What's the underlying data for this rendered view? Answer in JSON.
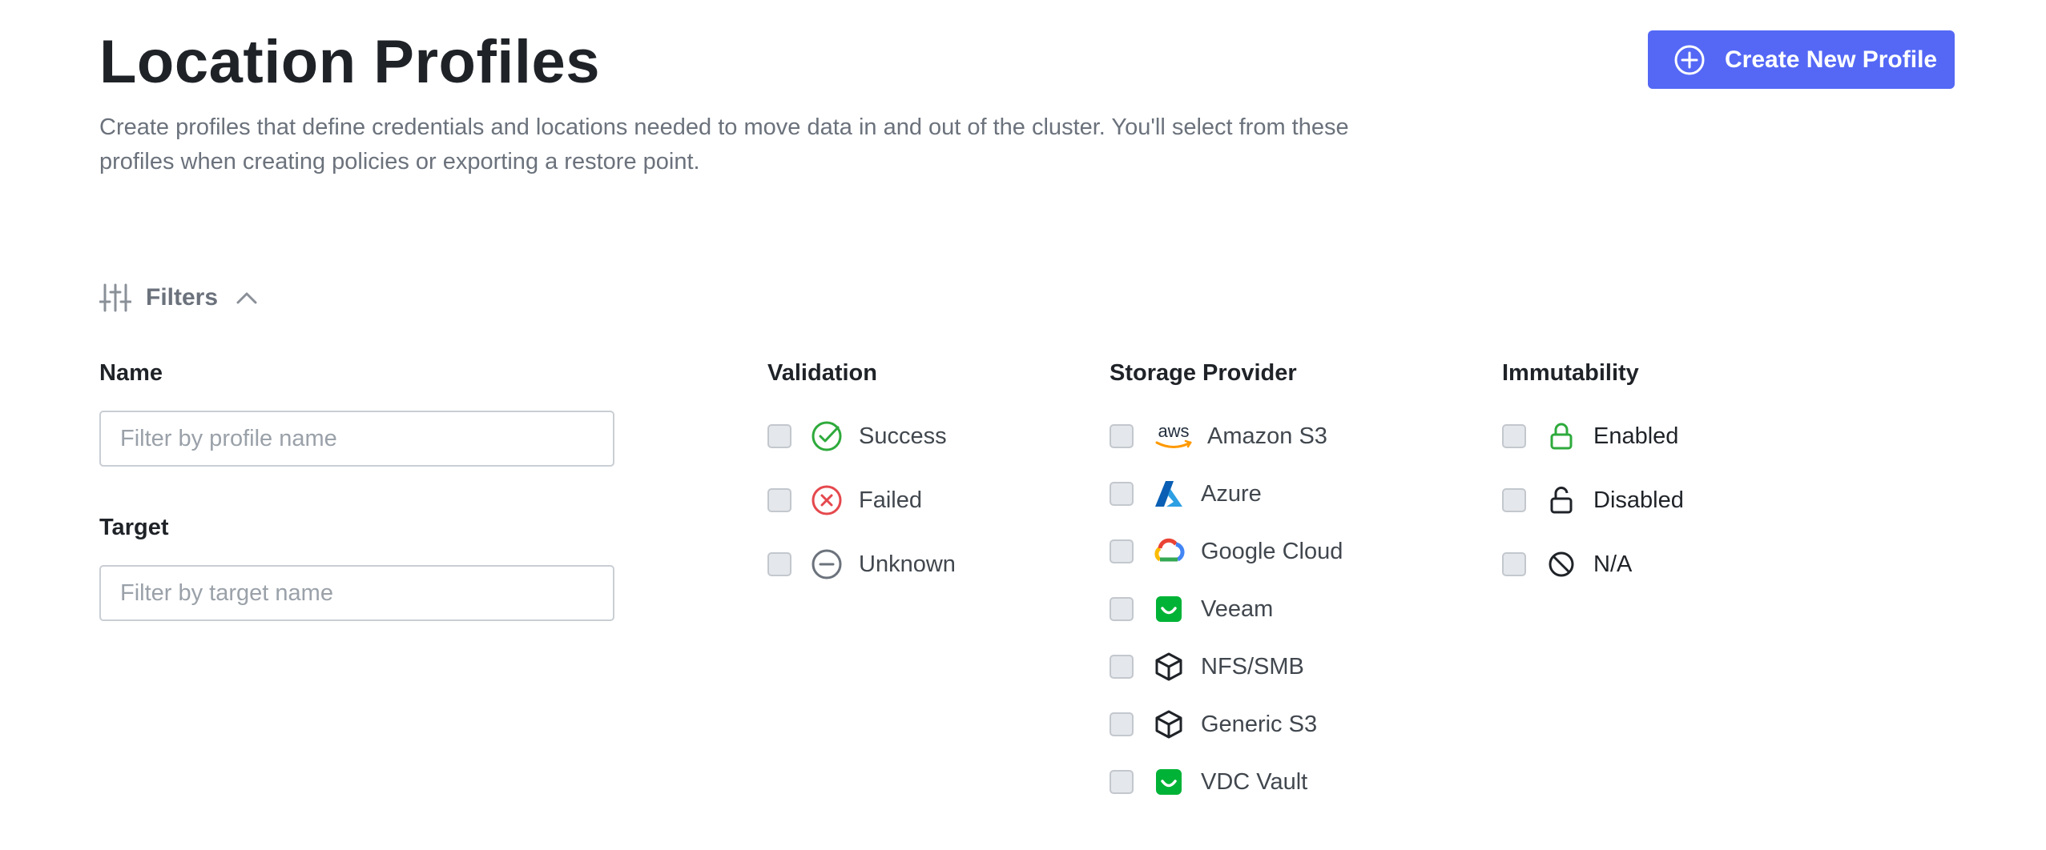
{
  "header": {
    "title": "Location Profiles",
    "description": "Create profiles that define credentials and locations needed to move data in and out of the cluster. You'll select from these profiles when creating policies or exporting a restore point.",
    "create_button_label": "Create New Profile",
    "create_button_color": "#5468f5"
  },
  "filters": {
    "toggle_label": "Filters",
    "name": {
      "label": "Name",
      "placeholder": "Filter by profile name",
      "value": ""
    },
    "target": {
      "label": "Target",
      "placeholder": "Filter by target name",
      "value": ""
    },
    "validation": {
      "title": "Validation",
      "options": [
        {
          "label": "Success",
          "icon": "check-circle-icon",
          "color": "#2eaa3c",
          "checked": false
        },
        {
          "label": "Failed",
          "icon": "x-circle-icon",
          "color": "#e5484d",
          "checked": false
        },
        {
          "label": "Unknown",
          "icon": "minus-circle-icon",
          "color": "#6b727c",
          "checked": false
        }
      ]
    },
    "storage_provider": {
      "title": "Storage Provider",
      "options": [
        {
          "label": "Amazon S3",
          "icon": "aws-icon",
          "checked": false
        },
        {
          "label": "Azure",
          "icon": "azure-icon",
          "checked": false
        },
        {
          "label": "Google Cloud",
          "icon": "google-cloud-icon",
          "checked": false
        },
        {
          "label": "Veeam",
          "icon": "veeam-icon",
          "checked": false
        },
        {
          "label": "NFS/SMB",
          "icon": "cube-icon",
          "checked": false
        },
        {
          "label": "Generic S3",
          "icon": "cube-icon",
          "checked": false
        },
        {
          "label": "VDC Vault",
          "icon": "veeam-icon",
          "checked": false
        }
      ]
    },
    "immutability": {
      "title": "Immutability",
      "options": [
        {
          "label": "Enabled",
          "icon": "lock-icon",
          "color": "#2eaa3c",
          "checked": false
        },
        {
          "label": "Disabled",
          "icon": "unlock-icon",
          "color": "#1f2328",
          "checked": false
        },
        {
          "label": "N/A",
          "icon": "ban-icon",
          "color": "#1f2328",
          "checked": false
        }
      ]
    }
  }
}
